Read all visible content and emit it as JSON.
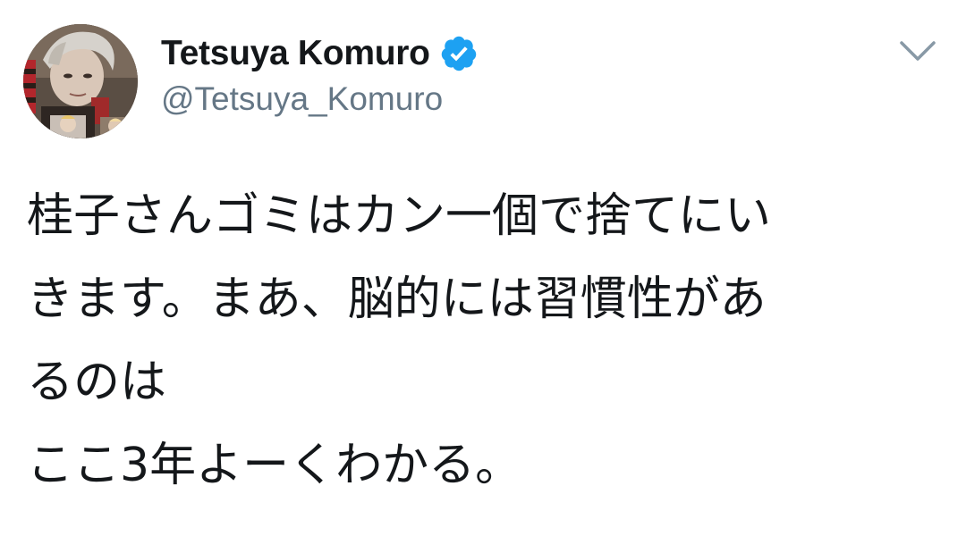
{
  "tweet": {
    "display_name": "Tetsuya Komuro",
    "handle": "@Tetsuya_Komuro",
    "verified": true,
    "text_lines": [
      "桂子さんゴミはカン一個で捨てにい",
      "きます。まあ、脳的には習慣性があ",
      "るのは",
      "ここ3年よーくわかる。"
    ]
  },
  "icons": {
    "verified": "verified-badge-icon",
    "menu": "chevron-down-icon"
  },
  "colors": {
    "text": "#14171a",
    "secondary": "#657786",
    "verified_blue": "#1da1f2"
  }
}
